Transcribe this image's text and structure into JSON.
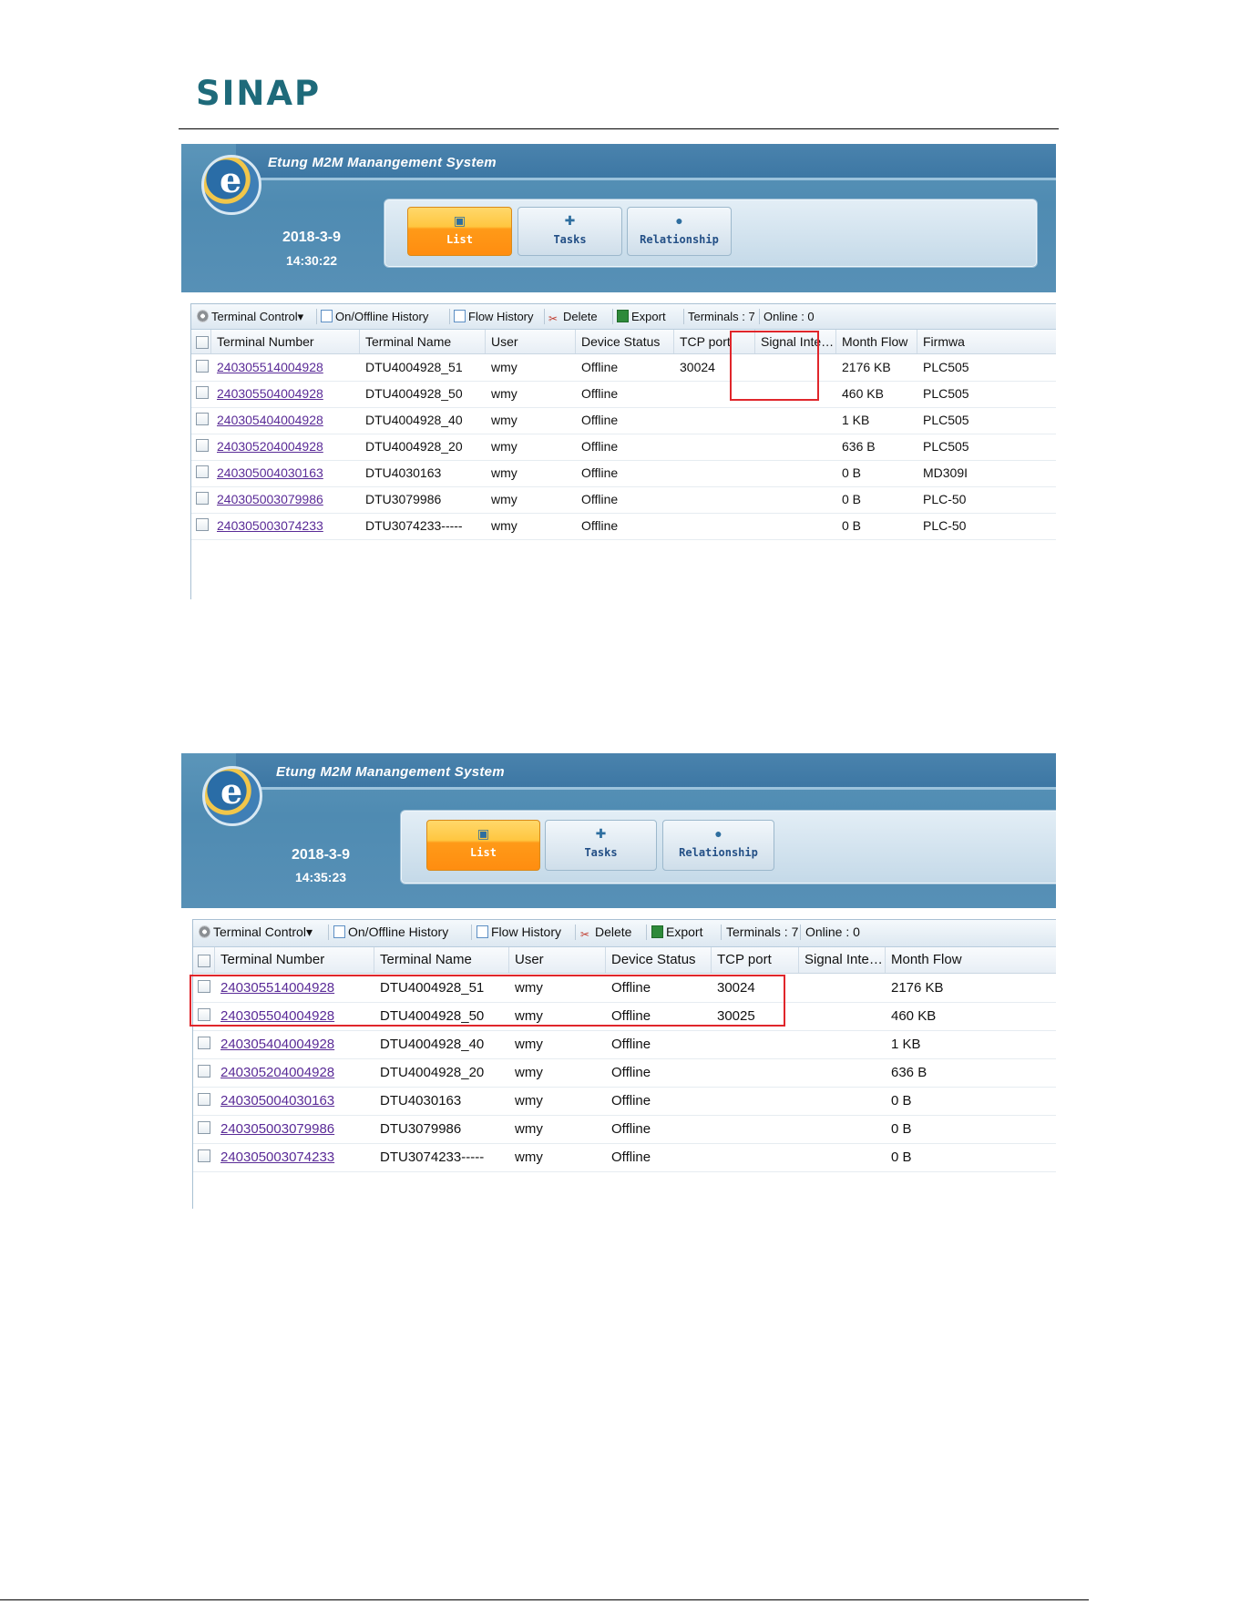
{
  "doc": {
    "brand": "SINAP"
  },
  "app": {
    "title": "Etung M2M Manangement System",
    "emblem_letter": "e"
  },
  "nav": {
    "tabs": [
      {
        "label": "List",
        "icon": "monitor-icon",
        "active": true
      },
      {
        "label": "Tasks",
        "icon": "tasks-icon",
        "active": false
      },
      {
        "label": "Relationship",
        "icon": "user-icon",
        "active": false
      }
    ]
  },
  "toolbar": {
    "terminal_control": "Terminal Control",
    "onoffline_history": "On/Offline History",
    "flow_history": "Flow History",
    "delete": "Delete",
    "export": "Export",
    "terminals_count": "Terminals : 7",
    "online_count": "Online : 0"
  },
  "columns": [
    "Terminal Number",
    "Terminal Name",
    "User",
    "Device Status",
    "TCP port",
    "Signal Inte…",
    "Month Flow",
    "Firmwa"
  ],
  "screenshot1": {
    "date": "2018-3-9",
    "time": "14:30:22",
    "rows": [
      {
        "number": "240305514004928",
        "name": "DTU4004928_51",
        "user": "wmy",
        "status": "Offline",
        "tcp": "30024",
        "signal": "",
        "flow": "2176 KB",
        "firmware": "PLC505"
      },
      {
        "number": "240305504004928",
        "name": "DTU4004928_50",
        "user": "wmy",
        "status": "Offline",
        "tcp": "",
        "signal": "",
        "flow": "460 KB",
        "firmware": "PLC505"
      },
      {
        "number": "240305404004928",
        "name": "DTU4004928_40",
        "user": "wmy",
        "status": "Offline",
        "tcp": "",
        "signal": "",
        "flow": "1 KB",
        "firmware": "PLC505"
      },
      {
        "number": "240305204004928",
        "name": "DTU4004928_20",
        "user": "wmy",
        "status": "Offline",
        "tcp": "",
        "signal": "",
        "flow": "636 B",
        "firmware": "PLC505"
      },
      {
        "number": "240305004030163",
        "name": "DTU4030163",
        "user": "wmy",
        "status": "Offline",
        "tcp": "",
        "signal": "",
        "flow": "0 B",
        "firmware": "MD309I"
      },
      {
        "number": "240305003079986",
        "name": "DTU3079986",
        "user": "wmy",
        "status": "Offline",
        "tcp": "",
        "signal": "",
        "flow": "0 B",
        "firmware": "PLC-50"
      },
      {
        "number": "240305003074233",
        "name": "DTU3074233-----",
        "user": "wmy",
        "status": "Offline",
        "tcp": "",
        "signal": "",
        "flow": "0 B",
        "firmware": "PLC-50"
      }
    ]
  },
  "screenshot2": {
    "date": "2018-3-9",
    "time": "14:35:23",
    "rows": [
      {
        "number": "240305514004928",
        "name": "DTU4004928_51",
        "user": "wmy",
        "status": "Offline",
        "tcp": "30024",
        "signal": "",
        "flow": "2176 KB"
      },
      {
        "number": "240305504004928",
        "name": "DTU4004928_50",
        "user": "wmy",
        "status": "Offline",
        "tcp": "30025",
        "signal": "",
        "flow": "460 KB"
      },
      {
        "number": "240305404004928",
        "name": "DTU4004928_40",
        "user": "wmy",
        "status": "Offline",
        "tcp": "",
        "signal": "",
        "flow": "1 KB"
      },
      {
        "number": "240305204004928",
        "name": "DTU4004928_20",
        "user": "wmy",
        "status": "Offline",
        "tcp": "",
        "signal": "",
        "flow": "636 B"
      },
      {
        "number": "240305004030163",
        "name": "DTU4030163",
        "user": "wmy",
        "status": "Offline",
        "tcp": "",
        "signal": "",
        "flow": "0 B"
      },
      {
        "number": "240305003079986",
        "name": "DTU3079986",
        "user": "wmy",
        "status": "Offline",
        "tcp": "",
        "signal": "",
        "flow": "0 B"
      },
      {
        "number": "240305003074233",
        "name": "DTU3074233-----",
        "user": "wmy",
        "status": "Offline",
        "tcp": "",
        "signal": "",
        "flow": "0 B"
      }
    ]
  },
  "colors": {
    "brand": "#1e6a7a",
    "header_blue": "#5790b6",
    "active_tab": "#ff9a18",
    "link": "#5a2b97",
    "highlight_box": "#e0262b"
  }
}
